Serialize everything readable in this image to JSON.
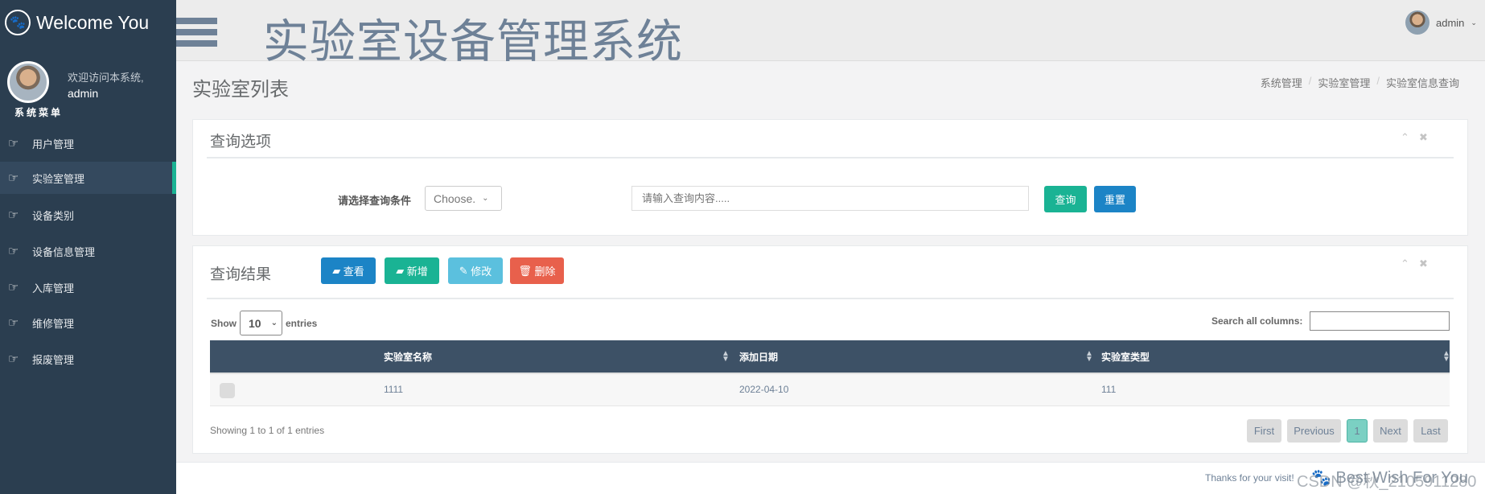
{
  "sidebar": {
    "brand": "Welcome You",
    "welcome": "欢迎访问本系统,",
    "username": "admin",
    "menu_title": "系统菜单",
    "items": [
      {
        "label": "用户管理"
      },
      {
        "label": "实验室管理",
        "active": true
      },
      {
        "label": "设备类别"
      },
      {
        "label": "设备信息管理"
      },
      {
        "label": "入库管理"
      },
      {
        "label": "维修管理"
      },
      {
        "label": "报废管理"
      }
    ]
  },
  "header": {
    "title": "实验室设备管理系统",
    "user": "admin"
  },
  "page": {
    "title": "实验室列表",
    "breadcrumb": [
      "系统管理",
      "实验室管理",
      "实验室信息查询"
    ]
  },
  "query": {
    "title": "查询选项",
    "label": "请选择查询条件",
    "select_value": "Choose.",
    "placeholder": "请输入查询内容.....",
    "search_btn": "查询",
    "reset_btn": "重置"
  },
  "results": {
    "title": "查询结果",
    "buttons": {
      "view": "查看",
      "add": "新增",
      "edit": "修改",
      "delete": "删除"
    },
    "show": "Show",
    "length": "10",
    "entries": "entries",
    "search_label": "Search all columns:",
    "columns": [
      "实验室名称",
      "添加日期",
      "实验室类型"
    ],
    "rows": [
      [
        "1111",
        "2022-04-10",
        "111"
      ]
    ],
    "info": "Showing 1 to 1 of 1 entries",
    "pagination": {
      "first": "First",
      "previous": "Previous",
      "current": "1",
      "next": "Next",
      "last": "Last"
    }
  },
  "footer": {
    "text": "Thanks for your visit!",
    "wish": "Best Wish For You",
    "watermark": "CSDN @秋_2105911280"
  },
  "colors": {
    "sidebar": "#2b3e50",
    "accent": "#1ab394",
    "primary": "#1c84c6",
    "info": "#5bc0de",
    "danger": "#ed5565",
    "table_header": "#3d5166"
  }
}
